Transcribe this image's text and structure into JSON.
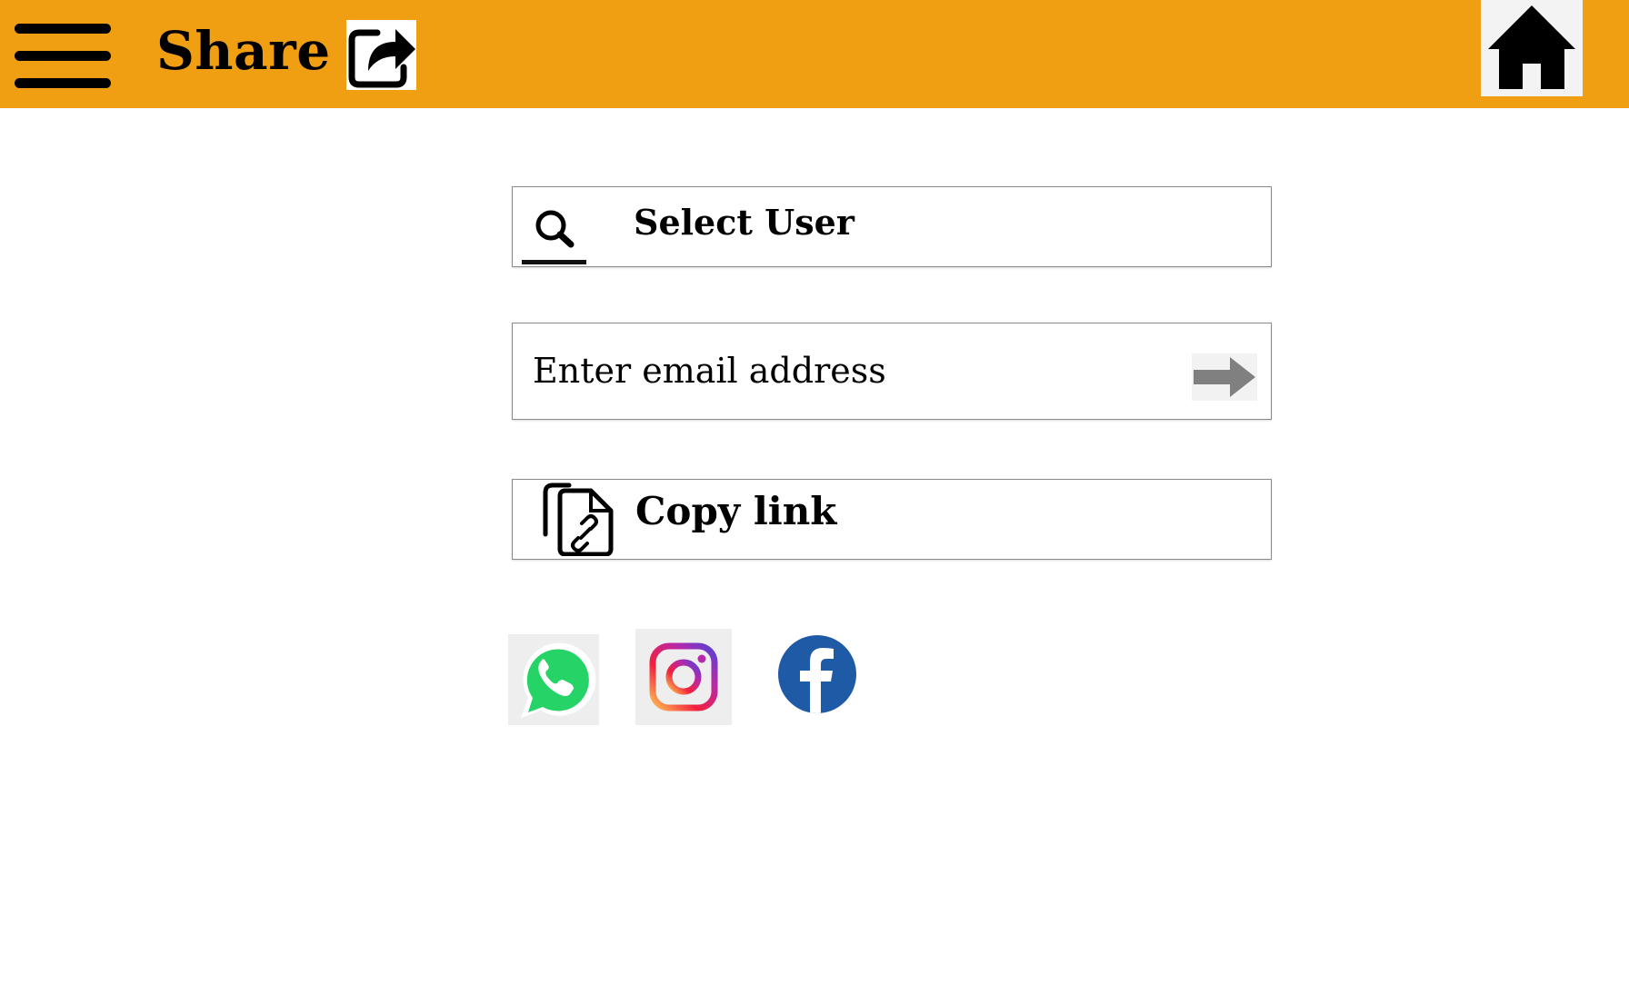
{
  "header": {
    "title": "Share",
    "menu_icon": "hamburger-menu-icon",
    "share_icon": "share-arrow-icon",
    "home_icon": "home-icon",
    "background_color": "#F09E12"
  },
  "select_user": {
    "label": "Select User",
    "icon": "search-icon"
  },
  "email": {
    "placeholder": "Enter email address",
    "value": "",
    "submit_icon": "right-arrow-icon"
  },
  "copy_link": {
    "label": "Copy link",
    "icon": "copy-link-icon"
  },
  "social": [
    {
      "name": "WhatsApp",
      "icon": "whatsapp-icon",
      "color": "#25D366"
    },
    {
      "name": "Instagram",
      "icon": "instagram-icon",
      "color": "#C13584"
    },
    {
      "name": "Facebook",
      "icon": "facebook-icon",
      "color": "#1F5AA6"
    }
  ]
}
